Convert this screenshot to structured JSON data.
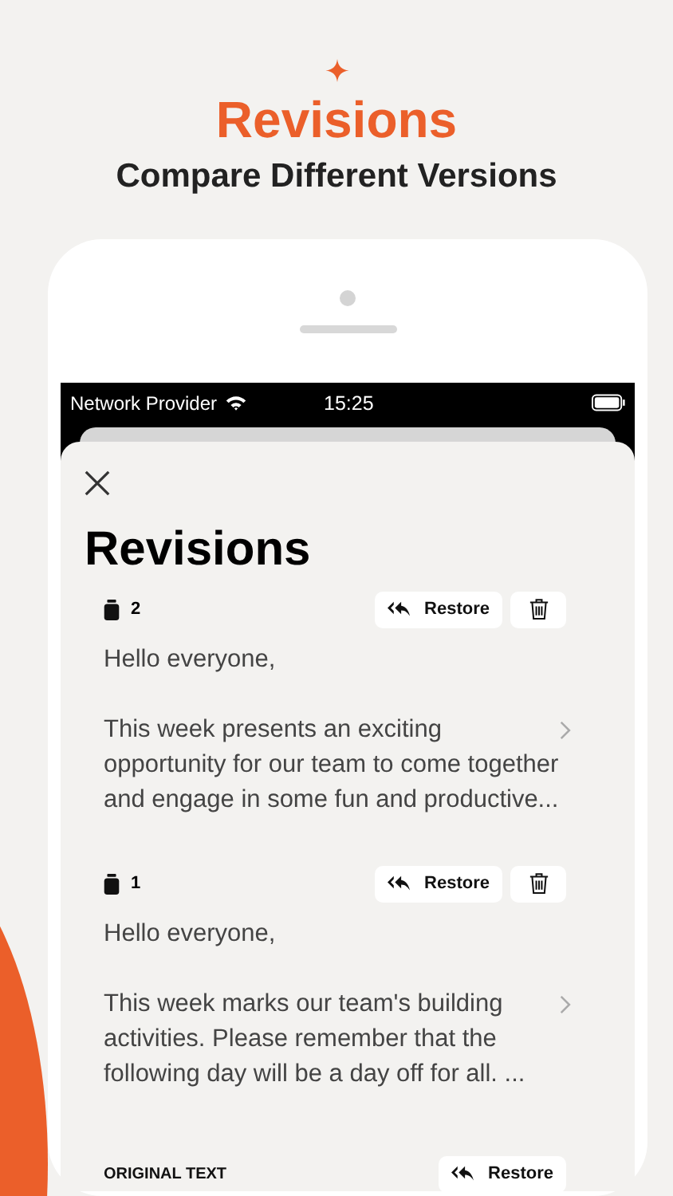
{
  "header": {
    "title": "Revisions",
    "subtitle": "Compare Different Versions"
  },
  "status_bar": {
    "carrier": "Network Provider",
    "time": "15:25"
  },
  "sheet": {
    "title": "Revisions"
  },
  "revisions": [
    {
      "kind": "version",
      "number": "2",
      "restore": "Restore",
      "greeting": "Hello everyone,",
      "body": "This week presents an exciting opportunity for our team to come together and engage in some fun and productive..."
    },
    {
      "kind": "version",
      "number": "1",
      "restore": "Restore",
      "greeting": "Hello everyone,",
      "body": "This week marks our team's building activities. Please remember that the following day will be a day off for all.  ..."
    },
    {
      "kind": "original",
      "label": "ORIGINAL TEXT",
      "restore": "Restore"
    }
  ]
}
